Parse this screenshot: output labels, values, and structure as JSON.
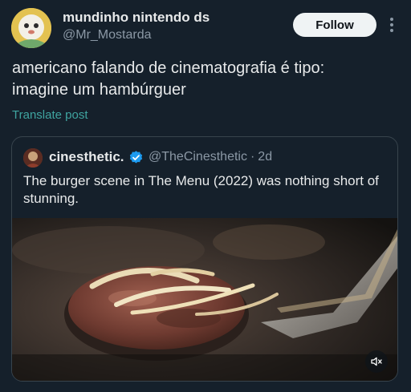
{
  "author": {
    "name": "mundinho nintendo ds",
    "handle": "@Mr_Mostarda"
  },
  "follow_label": "Follow",
  "post_text": "americano falando de cinematografia  é tipo:\nimagine um hambúrguer",
  "translate_label": "Translate post",
  "quoted": {
    "name": "cinesthetic.",
    "handle": "@TheCinesthetic",
    "separator": "·",
    "time": "2d",
    "text": "The burger scene in The Menu (2022) was nothing short of stunning.",
    "verified": true
  },
  "media": {
    "type": "video",
    "muted": true
  },
  "icons": {
    "more": "more-vertical-icon",
    "verified": "verified-badge-icon",
    "mute": "volume-muted-icon"
  },
  "colors": {
    "background": "#15202b",
    "link": "#3fa4a0",
    "verified": "#1d9bf0",
    "muted_text": "#8b98a5"
  }
}
